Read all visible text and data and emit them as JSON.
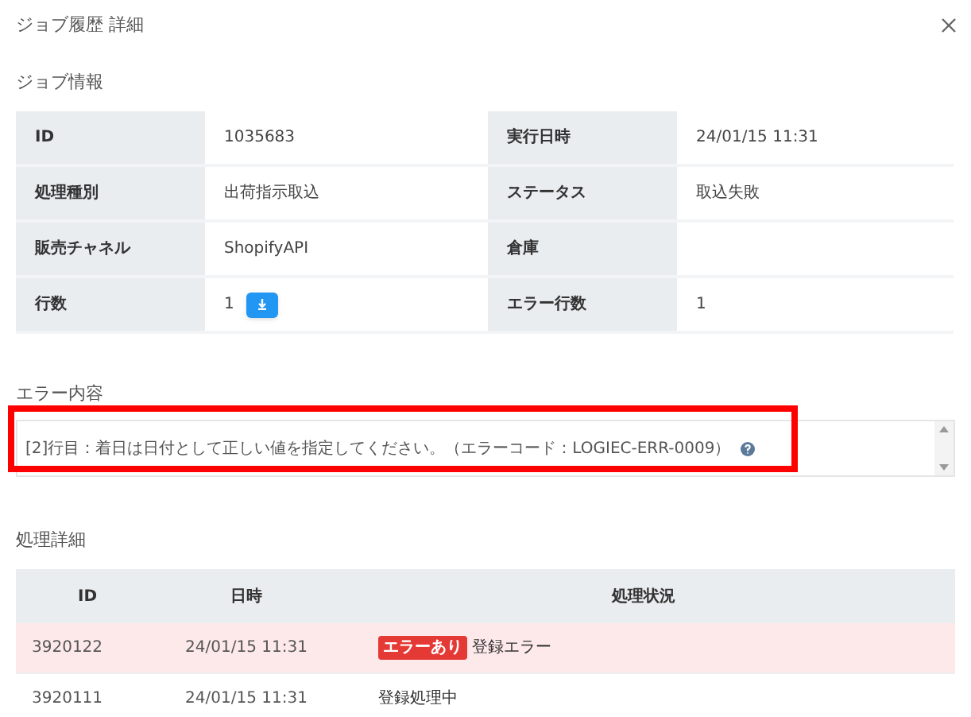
{
  "dialog": {
    "title": "ジョブ履歴 詳細"
  },
  "job_info": {
    "heading": "ジョブ情報",
    "rows": [
      {
        "label_1": "ID",
        "value_1": "1035683",
        "label_2": "実行日時",
        "value_2": "24/01/15 11:31"
      },
      {
        "label_1": "処理種別",
        "value_1": "出荷指示取込",
        "label_2": "ステータス",
        "value_2": "取込失敗"
      },
      {
        "label_1": "販売チャネル",
        "value_1": "ShopifyAPI",
        "label_2": "倉庫",
        "value_2": ""
      },
      {
        "label_1": "行数",
        "value_1": "1",
        "download": true,
        "label_2": "エラー行数",
        "value_2": "1"
      }
    ]
  },
  "error": {
    "heading": "エラー内容",
    "message": "[2]行目：着日は日付として正しい値を指定してください。（エラーコード：LOGIEC-ERR-0009）",
    "highlighted": true
  },
  "details": {
    "heading": "処理詳細",
    "columns": [
      "ID",
      "日時",
      "処理状況"
    ],
    "rows": [
      {
        "id": "3920122",
        "datetime": "24/01/15 11:31",
        "badge": "エラーあり",
        "status": "登録エラー",
        "kind": "error"
      },
      {
        "id": "3920111",
        "datetime": "24/01/15 11:31",
        "status": "登録処理中",
        "kind": "normal"
      }
    ]
  }
}
